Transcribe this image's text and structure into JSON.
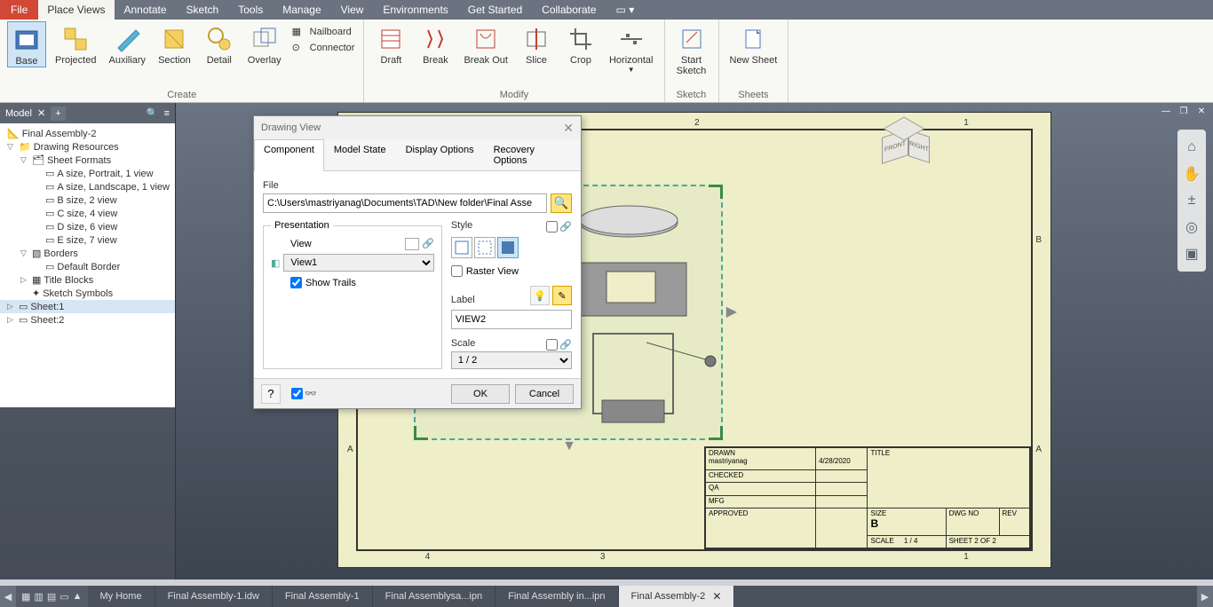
{
  "menubar": {
    "file": "File",
    "tabs": [
      "Place Views",
      "Annotate",
      "Sketch",
      "Tools",
      "Manage",
      "View",
      "Environments",
      "Get Started",
      "Collaborate"
    ]
  },
  "ribbon": {
    "create": {
      "label": "Create",
      "base": "Base",
      "projected": "Projected",
      "auxiliary": "Auxiliary",
      "section": "Section",
      "detail": "Detail",
      "overlay": "Overlay",
      "nailboard": "Nailboard",
      "connector": "Connector"
    },
    "modify": {
      "label": "Modify",
      "draft": "Draft",
      "break": "Break",
      "breakout": "Break Out",
      "slice": "Slice",
      "crop": "Crop",
      "horizontal": "Horizontal"
    },
    "sketch": {
      "label": "Sketch",
      "start": "Start\nSketch"
    },
    "sheets": {
      "label": "Sheets",
      "new": "New Sheet"
    }
  },
  "browser": {
    "title": "Model",
    "root": "Final Assembly-2",
    "drawing_resources": "Drawing Resources",
    "sheet_formats": "Sheet Formats",
    "formats": [
      "A size, Portrait, 1 view",
      "A size, Landscape, 1 view",
      "B size, 2 view",
      "C size, 4 view",
      "D size, 6 view",
      "E size, 7 view"
    ],
    "borders": "Borders",
    "default_border": "Default Border",
    "title_blocks": "Title Blocks",
    "sketch_symbols": "Sketch Symbols",
    "sheet1": "Sheet:1",
    "sheet2": "Sheet:2"
  },
  "dialog": {
    "title": "Drawing View",
    "tabs": [
      "Component",
      "Model State",
      "Display Options",
      "Recovery Options"
    ],
    "file_label": "File",
    "file_path": "C:\\Users\\mastriyanag\\Documents\\TAD\\New folder\\Final Asse",
    "presentation": "Presentation",
    "view_label": "View",
    "view_value": "View1",
    "show_trails": "Show Trails",
    "style_label": "Style",
    "raster_view": "Raster View",
    "label_label": "Label",
    "label_value": "VIEW2",
    "scale_label": "Scale",
    "scale_value": "1 / 2",
    "ok": "OK",
    "cancel": "Cancel"
  },
  "title_block": {
    "drawn": "DRAWN",
    "drawn_by": "mastriyanag",
    "drawn_date": "4/28/2020",
    "checked": "CHECKED",
    "qa": "QA",
    "mfg": "MFG",
    "approved": "APPROVED",
    "title": "TITLE",
    "size_label": "SIZE",
    "size": "B",
    "dwg_no": "DWG NO",
    "rev": "REV",
    "scale_label": "SCALE",
    "scale": "1 / 4",
    "sheet": "SHEET 2  OF  2"
  },
  "viewcube": {
    "front": "FRONT",
    "right": "RIGHT"
  },
  "bottom_tabs": {
    "home": "My Home",
    "tabs": [
      "Final Assembly-1.idw",
      "Final Assembly-1",
      "Final Assemblysa...ipn",
      "Final Assembly in...ipn",
      "Final Assembly-2"
    ]
  }
}
